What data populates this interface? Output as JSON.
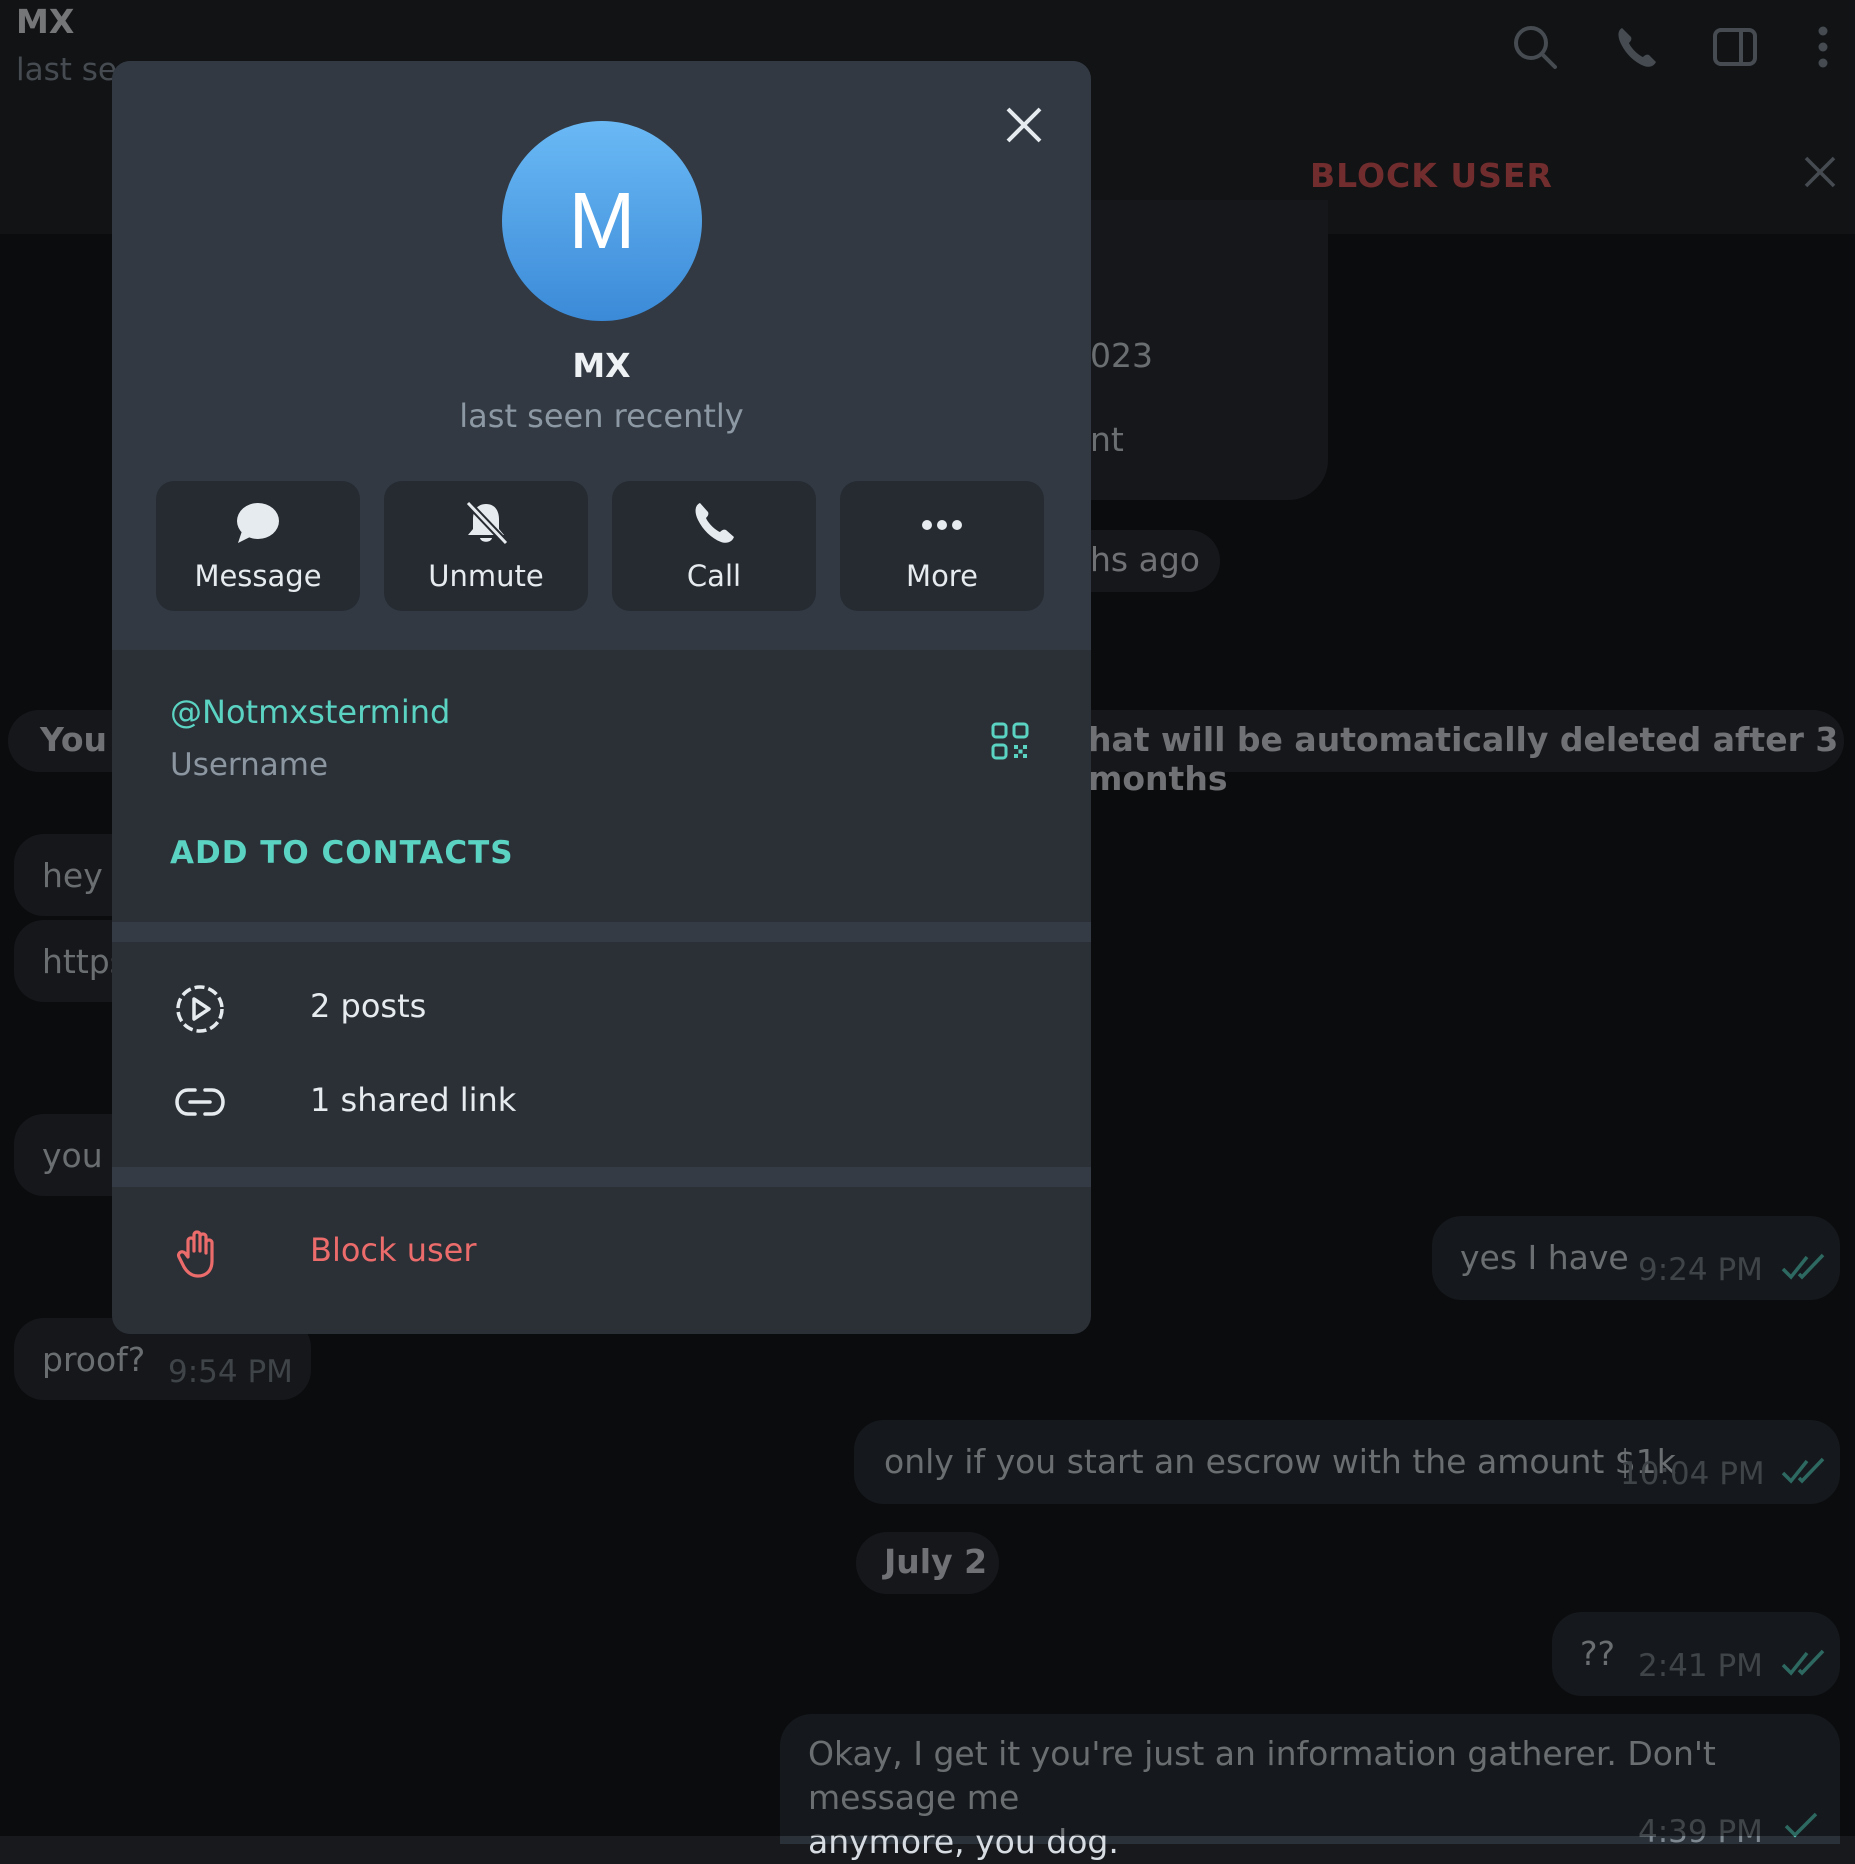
{
  "header": {
    "title": "MX",
    "status": "last se",
    "block_bar_label": "BLOCK USER"
  },
  "chat": {
    "fragment_year": "023",
    "fragment_nt": "nt",
    "fragment_months_ago": "hs ago",
    "service_left": "You s",
    "service_right": "hat will be automatically deleted after 3 months",
    "msg_hey": "hey",
    "msg_https": "https",
    "msg_you": "you h",
    "msg_proof": "proof?",
    "msg_proof_time": "9:54 PM",
    "msg_yes": "yes I have",
    "msg_yes_time": "9:24 PM",
    "msg_escrow": "only if you start an escrow with the amount $1k",
    "msg_escrow_time": "10:04 PM",
    "date_sep": "July 2",
    "msg_qq": "??",
    "msg_qq_time": "2:41 PM",
    "msg_last_line1": "Okay, I get it you're just an information gatherer. Don't message me",
    "msg_last_line2": "anymore, you dog.",
    "msg_last_time": "4:39 PM"
  },
  "profile": {
    "avatar_letter": "M",
    "name": "MX",
    "status": "last seen recently",
    "actions": [
      {
        "label": "Message",
        "icon": "message-icon"
      },
      {
        "label": "Unmute",
        "icon": "bell-off-icon"
      },
      {
        "label": "Call",
        "icon": "phone-icon"
      },
      {
        "label": "More",
        "icon": "more-dots-icon"
      }
    ],
    "username": "@Notmxstermind",
    "username_label": "Username",
    "add_to_contacts": "ADD TO CONTACTS",
    "posts": "2 posts",
    "shared_links": "1 shared link",
    "block_user": "Block user"
  },
  "colors": {
    "accent": "#5bd3c3",
    "danger": "#ec6b6b",
    "avatar_top": "#6ab9f5",
    "avatar_bottom": "#3b8ad8"
  }
}
